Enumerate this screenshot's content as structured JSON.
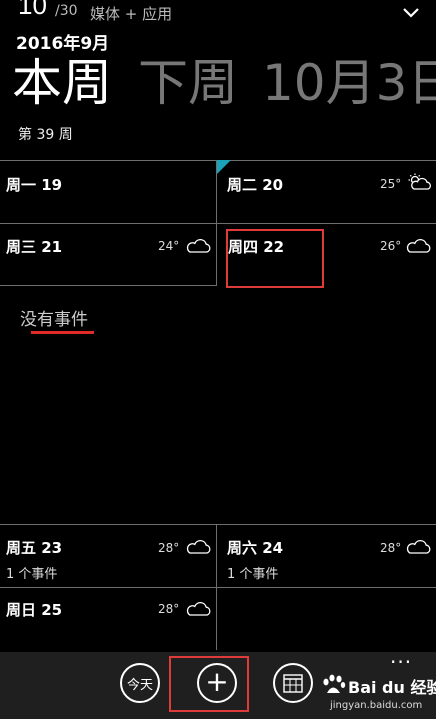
{
  "status": {
    "count": "10",
    "total": "/30",
    "category": "媒体 + 应用"
  },
  "header": {
    "month": "2016年9月",
    "this_week": "本周",
    "next_week": "下周",
    "date": "10月3日",
    "week_number": "第 39 周"
  },
  "days": [
    {
      "label": "周一 19"
    },
    {
      "label": "周二 20",
      "temp": "25°",
      "weather": "partly-sunny"
    },
    {
      "label": "周三 21",
      "temp": "24°",
      "weather": "cloudy"
    },
    {
      "label": "周四 22",
      "temp": "26°",
      "weather": "cloudy"
    },
    {
      "label": "周五 23",
      "temp": "28°",
      "weather": "cloudy",
      "events": "1 个事件"
    },
    {
      "label": "周六 24",
      "temp": "28°",
      "weather": "cloudy",
      "events": "1 个事件"
    },
    {
      "label": "周日 25",
      "temp": "28°",
      "weather": "cloudy"
    }
  ],
  "no_events": "没有事件",
  "appbar": {
    "today": "今天",
    "add": "+",
    "more": "..."
  },
  "watermark": {
    "brand": "Bai du 经验",
    "url": "jingyan.baidu.com"
  },
  "colors": {
    "highlight": "#e03b3b",
    "accent": "#1aa3b8",
    "background": "#000000"
  }
}
